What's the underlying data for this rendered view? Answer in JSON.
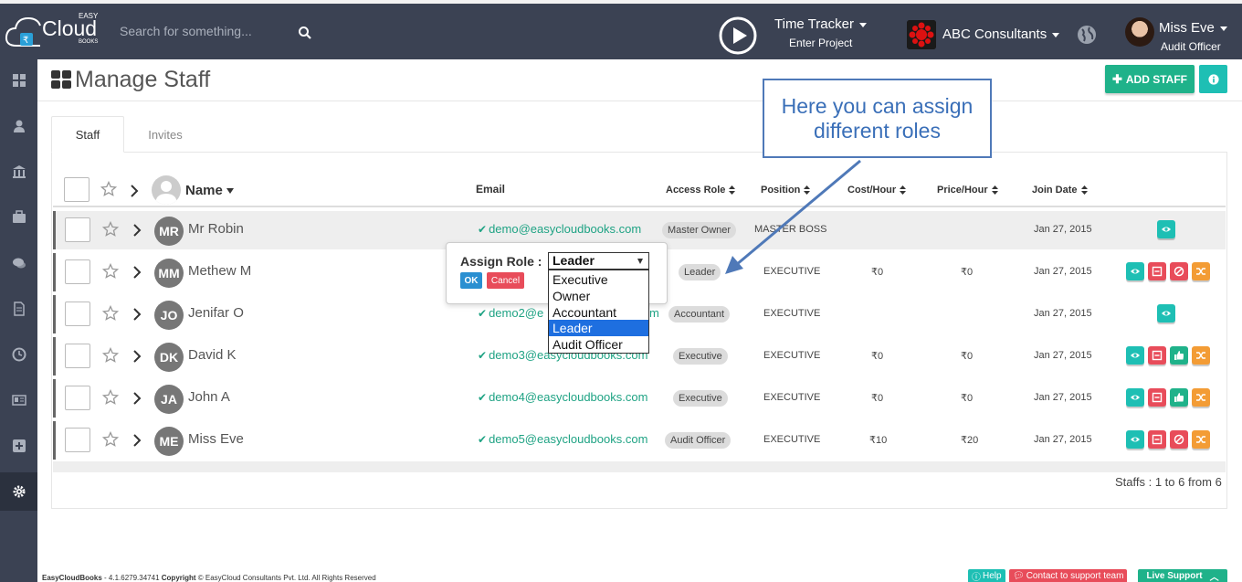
{
  "topbar": {
    "logo": {
      "brand": "Cloud",
      "easy": "EASY",
      "books": "BOOKS"
    },
    "search_placeholder": "Search for something...",
    "time_tracker": {
      "title": "Time Tracker",
      "sub": "Enter Project"
    },
    "company": "ABC Consultants",
    "user": {
      "name": "Miss Eve",
      "role": "Audit Officer"
    }
  },
  "page": {
    "title": "Manage Staff",
    "add_staff": "ADD STAFF"
  },
  "tabs": [
    {
      "label": "Staff"
    },
    {
      "label": "Invites"
    }
  ],
  "table": {
    "headers": {
      "name": "Name",
      "email": "Email",
      "access_role": "Access Role",
      "position": "Position",
      "cost": "Cost/Hour",
      "price": "Price/Hour",
      "join": "Join Date"
    },
    "rows": [
      {
        "initials": "MR",
        "name": "Mr Robin",
        "email": "demo@easycloudbooks.com",
        "role": "Master Owner",
        "position": "MASTER BOSS",
        "cost": "",
        "price": "",
        "join": "Jan 27, 2015"
      },
      {
        "initials": "MM",
        "name": "Methew M",
        "email": "",
        "role": "Leader",
        "position": "EXECUTIVE",
        "cost": "₹0",
        "price": "₹0",
        "join": "Jan 27, 2015"
      },
      {
        "initials": "JO",
        "name": "Jenifar O",
        "email": "demo2@easycloudbooks.com",
        "email_visible": "demo2@e",
        "email_tail": "m",
        "role": "Accountant",
        "position": "EXECUTIVE",
        "cost": "",
        "price": "",
        "join": "Jan 27, 2015"
      },
      {
        "initials": "DK",
        "name": "David K",
        "email": "demo3@easycloudbooks.com",
        "role": "Executive",
        "position": "EXECUTIVE",
        "cost": "₹0",
        "price": "₹0",
        "join": "Jan 27, 2015"
      },
      {
        "initials": "JA",
        "name": "John A",
        "email": "demo4@easycloudbooks.com",
        "role": "Executive",
        "position": "EXECUTIVE",
        "cost": "₹0",
        "price": "₹0",
        "join": "Jan 27, 2015"
      },
      {
        "initials": "ME",
        "name": "Miss Eve",
        "email": "demo5@easycloudbooks.com",
        "role": "Audit Officer",
        "position": "EXECUTIVE",
        "cost": "₹10",
        "price": "₹20",
        "join": "Jan 27, 2015"
      }
    ],
    "count": "Staffs : 1 to 6 from 6"
  },
  "assign_popup": {
    "label": "Assign Role :",
    "selected": "Leader",
    "options": [
      "Executive",
      "Owner",
      "Accountant",
      "Leader",
      "Audit Officer"
    ],
    "ok": "OK",
    "cancel": "Cancel"
  },
  "callout": "Here you can assign different roles",
  "footer": {
    "app": "EasyCloudBooks",
    "version": "- 4.1.6279.34741",
    "copyright_label": "Copyright",
    "copyright": "© EasyCloud Consultants Pvt. Ltd. All Rights Reserved",
    "help": "Help",
    "contact": "Contact to support team",
    "live": "Live Support"
  },
  "colors": {
    "topbar": "#3b4253",
    "teal": "#1ebfb4",
    "green": "#1fb28a",
    "red": "#e84c5a",
    "orange": "#f39c35",
    "blue": "#2a8fd1",
    "callout": "#4f79b8"
  }
}
